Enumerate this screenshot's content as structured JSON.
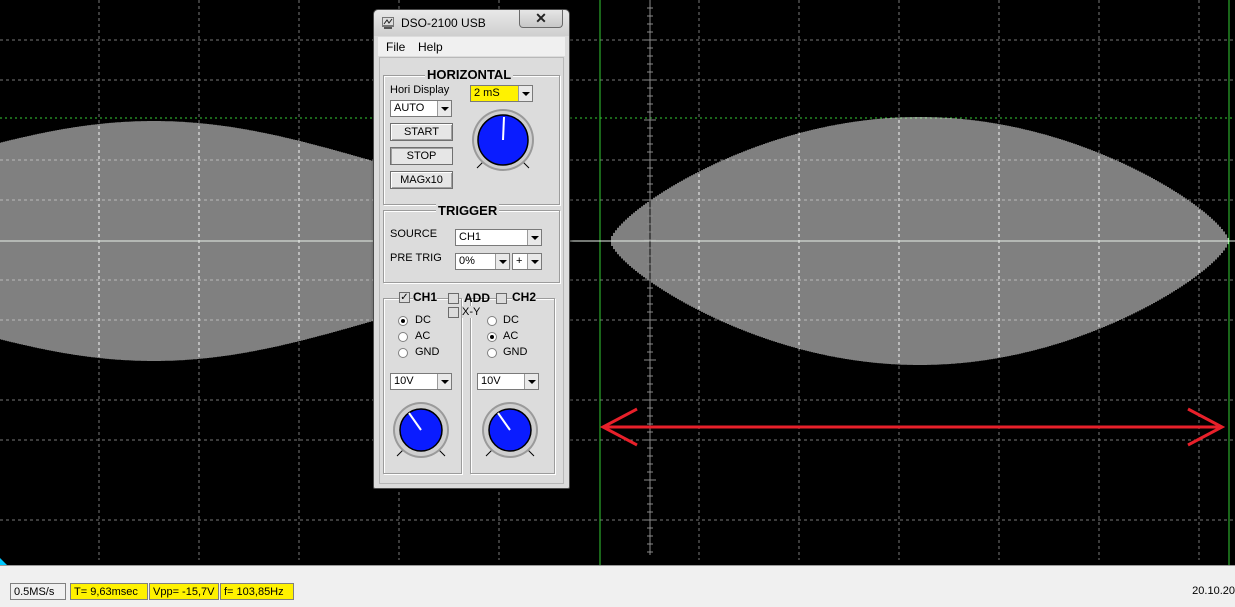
{
  "window": {
    "title": "DSO-2100 USB",
    "close_label": "✕"
  },
  "menu": [
    "File",
    "Help"
  ],
  "horizontal": {
    "title": "HORIZONTAL",
    "hori_display_label": "Hori Display",
    "mode_value": "AUTO",
    "timebase_value": "2 mS",
    "start_label": "START",
    "stop_label": "STOP",
    "mag_label": "MAGx10"
  },
  "trigger": {
    "title": "TRIGGER",
    "source_label": "SOURCE",
    "source_value": "CH1",
    "pretrig_label": "PRE TRIG",
    "pretrig_value": "0%",
    "edge_value": "+"
  },
  "channels": {
    "ch1_label": "CH1",
    "ch1_checked": true,
    "add_label": "ADD",
    "xy_label": "X-Y",
    "ch2_label": "CH2",
    "ch1_coupling": [
      "DC",
      "AC",
      "GND"
    ],
    "ch1_selected": "DC",
    "ch2_coupling": [
      "DC",
      "AC",
      "GND"
    ],
    "ch2_selected": "AC",
    "ch1_volts": "10V",
    "ch2_volts": "10V"
  },
  "status": {
    "sample_rate": "0.5MS/s",
    "period": "T= 9,63msec",
    "vpp": "Vpp= -15,7V",
    "freq": "f= 103,85Hz",
    "date": "20.10.20"
  },
  "colors": {
    "grid": "#777777",
    "trigger_line": "#33cc33",
    "trace": "#ffffff",
    "arrow": "#e8202a",
    "highlight": "#fff200",
    "knob": "#0a1cff"
  }
}
